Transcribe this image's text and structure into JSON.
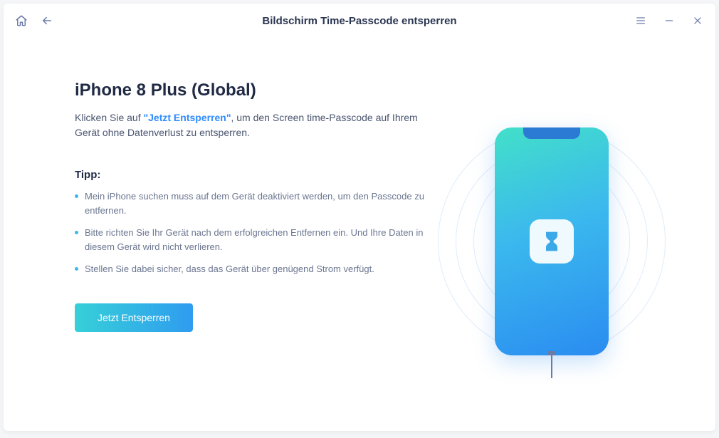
{
  "titlebar": {
    "title": "Bildschirm Time-Passcode entsperren"
  },
  "main": {
    "device_name": "iPhone 8 Plus (Global)",
    "desc_prefix": "Klicken Sie auf ",
    "desc_highlight": "\"Jetzt Entsperren\"",
    "desc_suffix": ", um den Screen time-Passcode auf Ihrem Gerät ohne Datenverlust zu entsperren.",
    "tips_title": "Tipp:",
    "tips": [
      "Mein iPhone suchen muss auf dem Gerät deaktiviert werden, um den Passcode zu entfernen.",
      "Bitte richten Sie Ihr Gerät nach dem erfolgreichen Entfernen ein. Und Ihre Daten in diesem Gerät wird nicht verlieren.",
      "Stellen Sie dabei sicher, dass das Gerät über genügend Strom verfügt."
    ],
    "unlock_button": "Jetzt Entsperren"
  },
  "illustration": {
    "center_icon": "hourglass-icon"
  }
}
